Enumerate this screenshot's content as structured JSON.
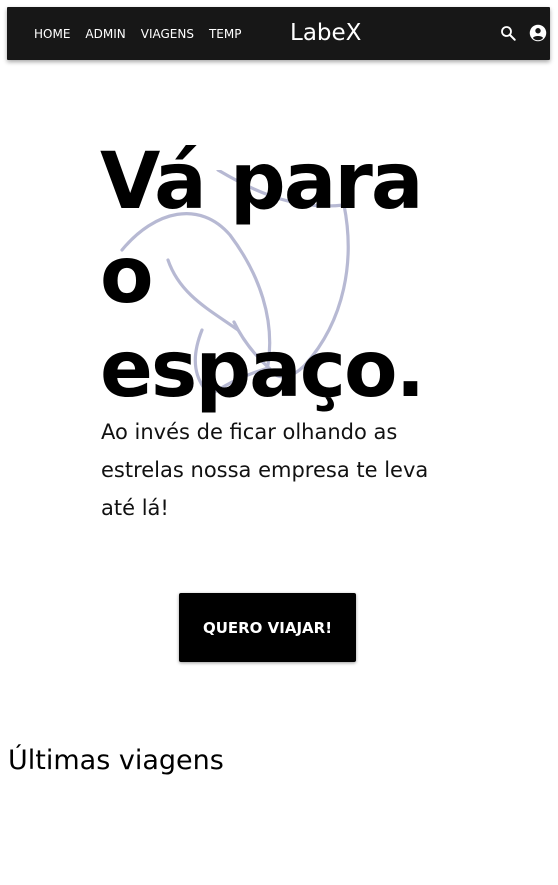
{
  "nav": {
    "links": [
      "HOME",
      "ADMIN",
      "VIAGENS",
      "TEMP"
    ],
    "brand": "LabeX",
    "search_icon": "search-icon",
    "account_icon": "account-circle-icon",
    "background": "#171717"
  },
  "hero": {
    "title": "Vá para o espaço.",
    "subtitle": "Ao invés de ficar olhando as estrelas nossa empresa te leva até lá!",
    "cta_label": "QUERO VIAJAR!",
    "art_icon": "rocket-illustration",
    "art_color": "#b7b9d3"
  },
  "trips": {
    "title": "Últimas viagens"
  }
}
